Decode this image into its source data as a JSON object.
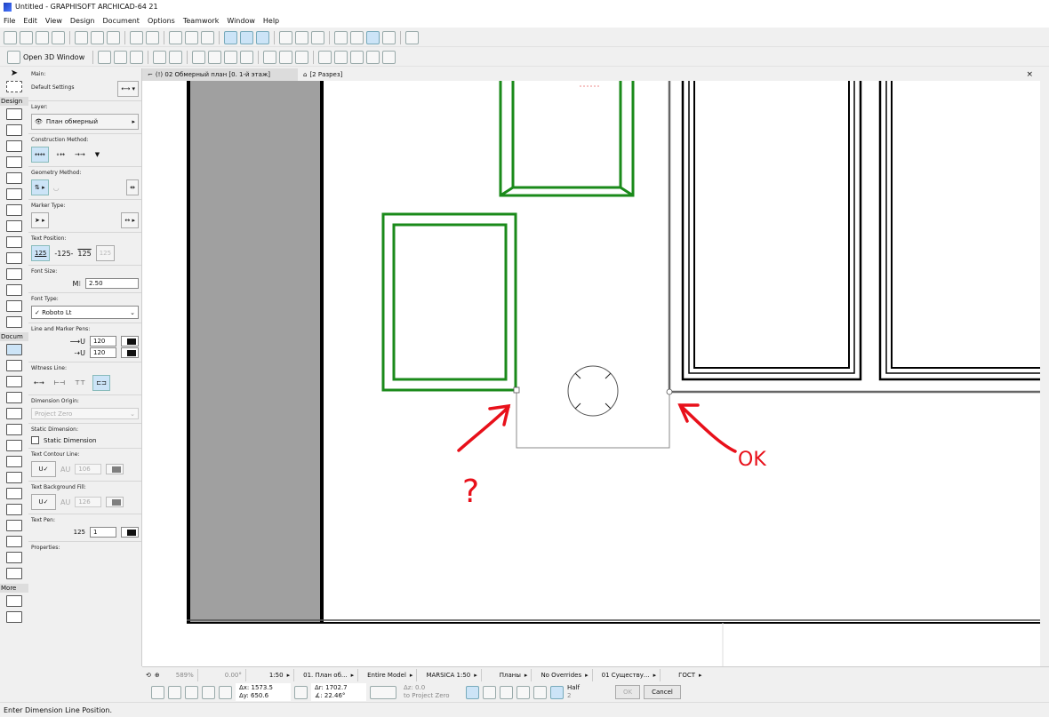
{
  "window": {
    "title": "Untitled - GRAPHISOFT ARCHICAD-64 21"
  },
  "menu": [
    "File",
    "Edit",
    "View",
    "Design",
    "Document",
    "Options",
    "Teamwork",
    "Window",
    "Help"
  ],
  "toolbar2": {
    "open3d": "Open 3D Window"
  },
  "tabs": [
    {
      "label": "(!) 02 Обмерный план [0. 1-й этаж]"
    },
    {
      "label": "[2 Разрез]"
    }
  ],
  "tabs_close": "×",
  "toolbox": {
    "design": "Design",
    "docum": "Docum",
    "more": "More"
  },
  "info": {
    "main": "Main:",
    "default_settings": "Default Settings",
    "layer_label": "Layer:",
    "layer_value": "План обмерный",
    "construction": "Construction Method:",
    "geometry": "Geometry Method:",
    "marker": "Marker Type:",
    "text_position": "Text Position:",
    "tp_values": [
      "125",
      "-125-",
      "125",
      "125"
    ],
    "font_size_label": "Font Size:",
    "font_size": "2.50",
    "font_type_label": "Font Type:",
    "font_type": "✓ Roboto Lt",
    "pens_label": "Line and Marker Pens:",
    "pen1": "120",
    "pen2": "120",
    "witness": "Witness Line:",
    "origin_label": "Dimension Origin:",
    "origin": "Project Zero",
    "static_label": "Static Dimension:",
    "static_check": "Static Dimension",
    "contour_label": "Text Contour Line:",
    "contour_pen": "106",
    "bgfill_label": "Text Background Fill:",
    "bgfill_pen": "126",
    "textpen_label": "Text Pen:",
    "textpen_prefix": "125",
    "textpen": "1",
    "properties": "Properties:"
  },
  "navbar": {
    "zoom": "589%",
    "angle": "0.00°",
    "scale": "1:50",
    "story": "01. План об...",
    "model": "Entire Model",
    "penset": "MARSICA 1:50",
    "layer_combo": "Планы",
    "overrides": "No Overrides",
    "renovation": "01 Существу...",
    "dim_std": "ГОСТ"
  },
  "controls": {
    "dx": "Δx: 1573.5",
    "dy": "Δy: 650.6",
    "dr": "Δr: 1702.7",
    "da": "∡: 22.46°",
    "dz": "Δz: 0.0",
    "dz_ref": "to Project Zero",
    "snap": "Half",
    "snap_n": "2",
    "ok": "OK",
    "cancel": "Cancel"
  },
  "annotations": {
    "question": "?",
    "ok": "OK"
  },
  "status": "Enter Dimension Line Position.",
  "colors": {
    "wall": "#a0a0a0",
    "window_green": "#1a8a1a",
    "annotation_red": "#e8101a"
  }
}
